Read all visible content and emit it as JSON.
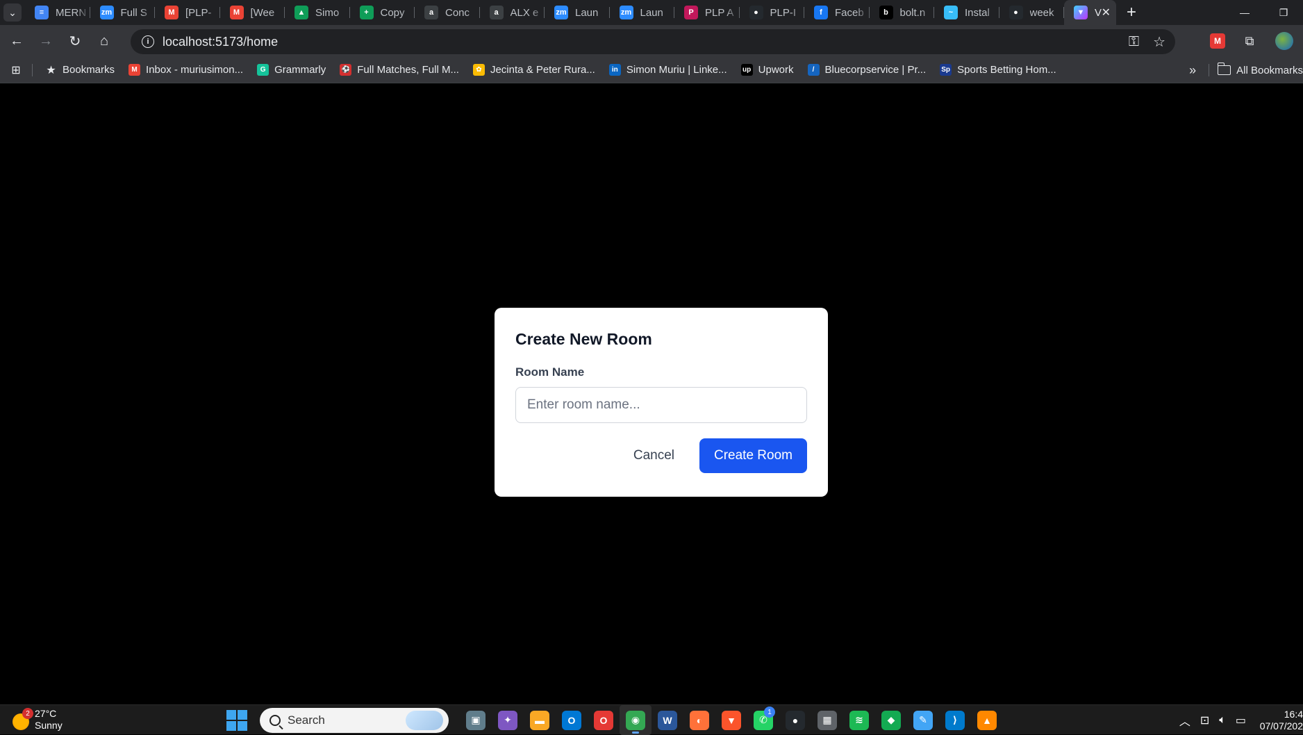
{
  "browser": {
    "tabs": [
      {
        "label": "MERN",
        "icon": "docs-icon",
        "color": "#4285f4",
        "glyph": "≡"
      },
      {
        "label": "Full S",
        "icon": "zoom-icon",
        "color": "#2d8cff",
        "glyph": "zm"
      },
      {
        "label": "[PLP-",
        "icon": "gmail-icon",
        "color": "#ea4335",
        "glyph": "M"
      },
      {
        "label": "[Wee",
        "icon": "gmail-icon",
        "color": "#ea4335",
        "glyph": "M"
      },
      {
        "label": "Simo",
        "icon": "drive-icon",
        "color": "#0f9d58",
        "glyph": "▲"
      },
      {
        "label": "Copy",
        "icon": "sheets-icon",
        "color": "#0f9d58",
        "glyph": "+"
      },
      {
        "label": "Conc",
        "icon": "alx-icon",
        "color": "#3c4043",
        "glyph": "a"
      },
      {
        "label": "ALX e",
        "icon": "alx-icon",
        "color": "#3c4043",
        "glyph": "a"
      },
      {
        "label": "Laun",
        "icon": "zoom-icon",
        "color": "#2d8cff",
        "glyph": "zm"
      },
      {
        "label": "Laun",
        "icon": "zoom-icon",
        "color": "#2d8cff",
        "glyph": "zm"
      },
      {
        "label": "PLP A",
        "icon": "plp-icon",
        "color": "#c2185b",
        "glyph": "P"
      },
      {
        "label": "PLP-I",
        "icon": "github-icon",
        "color": "#24292e",
        "glyph": "●"
      },
      {
        "label": "Faceb",
        "icon": "facebook-icon",
        "color": "#1877f2",
        "glyph": "f"
      },
      {
        "label": "bolt.n",
        "icon": "bolt-icon",
        "color": "#000000",
        "glyph": "b"
      },
      {
        "label": "Instal",
        "icon": "tailwind-icon",
        "color": "#38bdf8",
        "glyph": "~"
      },
      {
        "label": "week",
        "icon": "github-icon",
        "color": "#24292e",
        "glyph": "●"
      }
    ],
    "active_tab": {
      "label": "V",
      "icon": "vite-icon",
      "color": "#bd34fe",
      "glyph": "▼"
    },
    "url": "localhost:5173/home",
    "bookmarks": [
      {
        "label": "Bookmarks",
        "icon": "star-icon",
        "color": "transparent",
        "glyph": "★"
      },
      {
        "label": "Inbox - muriusimon...",
        "icon": "gmail-icon",
        "color": "#ea4335",
        "glyph": "M"
      },
      {
        "label": "Grammarly",
        "icon": "grammarly-icon",
        "color": "#15c39a",
        "glyph": "G"
      },
      {
        "label": "Full Matches, Full M...",
        "icon": "football-icon",
        "color": "#d32f2f",
        "glyph": "⚽"
      },
      {
        "label": "Jecinta & Peter Rura...",
        "icon": "photos-icon",
        "color": "#fbbc04",
        "glyph": "✿"
      },
      {
        "label": "Simon Muriu | Linke...",
        "icon": "linkedin-icon",
        "color": "#0a66c2",
        "glyph": "in"
      },
      {
        "label": "Upwork",
        "icon": "upwork-icon",
        "color": "#000000",
        "glyph": "up"
      },
      {
        "label": "Bluecorpservice | Pr...",
        "icon": "bluecorp-icon",
        "color": "#1565c0",
        "glyph": "/"
      },
      {
        "label": "Sports Betting Hom...",
        "icon": "sportpesa-icon",
        "color": "#1a3a8f",
        "glyph": "Sp"
      }
    ],
    "all_bookmarks": "All Bookmarks"
  },
  "modal": {
    "title": "Create New Room",
    "room_name_label": "Room Name",
    "room_name_value": "",
    "room_name_placeholder": "Enter room name...",
    "cancel_label": "Cancel",
    "create_label": "Create Room",
    "primary_color": "#1a56f0"
  },
  "taskbar": {
    "weather_temp": "27°C",
    "weather_desc": "Sunny",
    "weather_badge": "2",
    "search_placeholder": "Search",
    "apps": [
      {
        "name": "task-view-icon",
        "color": "#607d8b",
        "glyph": "▣"
      },
      {
        "name": "copilot-icon",
        "color": "#7e57c2",
        "glyph": "✦"
      },
      {
        "name": "file-explorer-icon",
        "color": "#f9a825",
        "glyph": "▬"
      },
      {
        "name": "outlook-icon",
        "color": "#0078d4",
        "glyph": "O"
      },
      {
        "name": "opera-icon",
        "color": "#e53935",
        "glyph": "O"
      },
      {
        "name": "chrome-icon",
        "color": "#34a853",
        "glyph": "◉",
        "active": true
      },
      {
        "name": "word-icon",
        "color": "#2b579a",
        "glyph": "W"
      },
      {
        "name": "firefox-icon",
        "color": "#ff7139",
        "glyph": "◐"
      },
      {
        "name": "brave-icon",
        "color": "#fb542b",
        "glyph": "▼"
      },
      {
        "name": "whatsapp-icon",
        "color": "#25d366",
        "glyph": "✆",
        "badge": "1"
      },
      {
        "name": "github-desktop-icon",
        "color": "#24292e",
        "glyph": "●"
      },
      {
        "name": "calculator-icon",
        "color": "#5f6368",
        "glyph": "▦"
      },
      {
        "name": "spotify-icon",
        "color": "#1db954",
        "glyph": "≋"
      },
      {
        "name": "mongodb-compass-icon",
        "color": "#13aa52",
        "glyph": "◆"
      },
      {
        "name": "paint-icon",
        "color": "#42a5f5",
        "glyph": "✎"
      },
      {
        "name": "vscode-icon",
        "color": "#007acc",
        "glyph": "⟩"
      },
      {
        "name": "vlc-icon",
        "color": "#ff8800",
        "glyph": "▲"
      }
    ],
    "time": "16:4",
    "date": "07/07/202"
  }
}
